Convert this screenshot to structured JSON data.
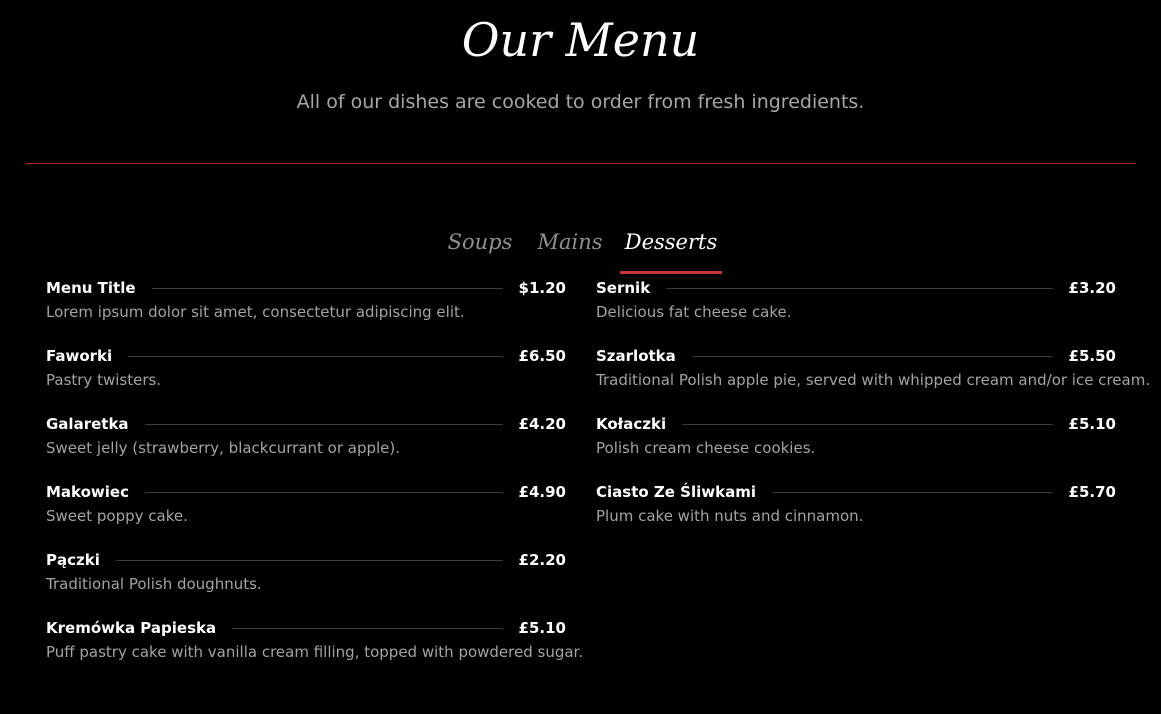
{
  "header": {
    "title": "Our Menu",
    "subtitle": "All of our dishes are cooked to order from fresh ingredients."
  },
  "colors": {
    "background": "#000000",
    "accent": "#c9343a",
    "text": "#ffffff",
    "muted": "#a3a3a3"
  },
  "tabs": [
    {
      "label": "Soups",
      "active": false
    },
    {
      "label": "Mains",
      "active": false
    },
    {
      "label": "Desserts",
      "active": true
    }
  ],
  "menu": {
    "left": [
      {
        "name": "Menu Title",
        "price": "$1.20",
        "description": "Lorem ipsum dolor sit amet, consectetur adipiscing elit."
      },
      {
        "name": "Faworki",
        "price": "£6.50",
        "description": "Pastry twisters."
      },
      {
        "name": "Galaretka",
        "price": "£4.20",
        "description": "Sweet jelly (strawberry, blackcurrant or apple)."
      },
      {
        "name": "Makowiec",
        "price": "£4.90",
        "description": "Sweet poppy cake."
      },
      {
        "name": "Pączki",
        "price": "£2.20",
        "description": "Traditional Polish doughnuts."
      },
      {
        "name": "Kremówka Papieska",
        "price": "£5.10",
        "description": "Puff pastry cake with vanilla cream filling, topped with powdered sugar."
      }
    ],
    "right": [
      {
        "name": "Sernik",
        "price": "£3.20",
        "description": "Delicious fat cheese cake."
      },
      {
        "name": "Szarlotka",
        "price": "£5.50",
        "description": "Traditional Polish apple pie, served with whipped cream and/or ice cream."
      },
      {
        "name": "Kołaczki",
        "price": "£5.10",
        "description": "Polish cream cheese cookies."
      },
      {
        "name": "Ciasto Ze Śliwkami",
        "price": "£5.70",
        "description": "Plum cake with nuts and cinnamon."
      }
    ]
  }
}
